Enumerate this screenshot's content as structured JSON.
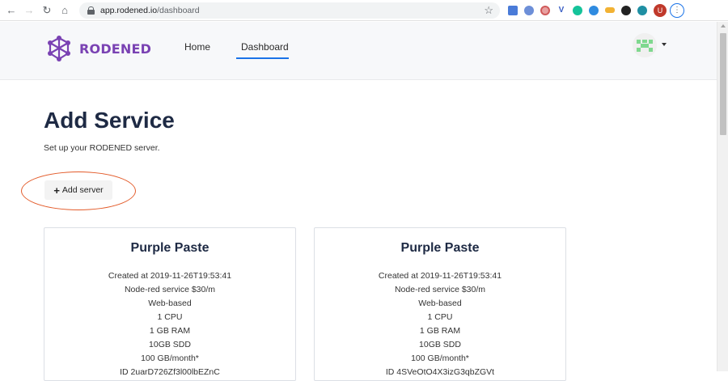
{
  "browser": {
    "url_host": "app.rodened.io",
    "url_path": "/dashboard",
    "profile_initial": "U"
  },
  "header": {
    "brand": "RODENED",
    "nav": [
      {
        "label": "Home"
      },
      {
        "label": "Dashboard",
        "active": true
      }
    ],
    "accent_color": "#1a73e8",
    "brand_color": "#7a42b3"
  },
  "main": {
    "title": "Add Service",
    "subtitle": "Set up your RODENED server.",
    "add_button_label": "Add server",
    "highlight_color": "#e35b2a"
  },
  "cards": [
    {
      "title": "Purple Paste",
      "lines": [
        "Created at 2019-11-26T19:53:41",
        "Node-red service $30/m",
        "Web-based",
        "1 CPU",
        "1 GB RAM",
        "10GB SDD",
        "100 GB/month*",
        "ID 2uarD726Zf3l00lbEZnC"
      ]
    },
    {
      "title": "Purple Paste",
      "lines": [
        "Created at 2019-11-26T19:53:41",
        "Node-red service $30/m",
        "Web-based",
        "1 CPU",
        "1 GB RAM",
        "10GB SDD",
        "100 GB/month*",
        "ID 4SVeOtO4X3izG3qbZGVt"
      ]
    }
  ]
}
